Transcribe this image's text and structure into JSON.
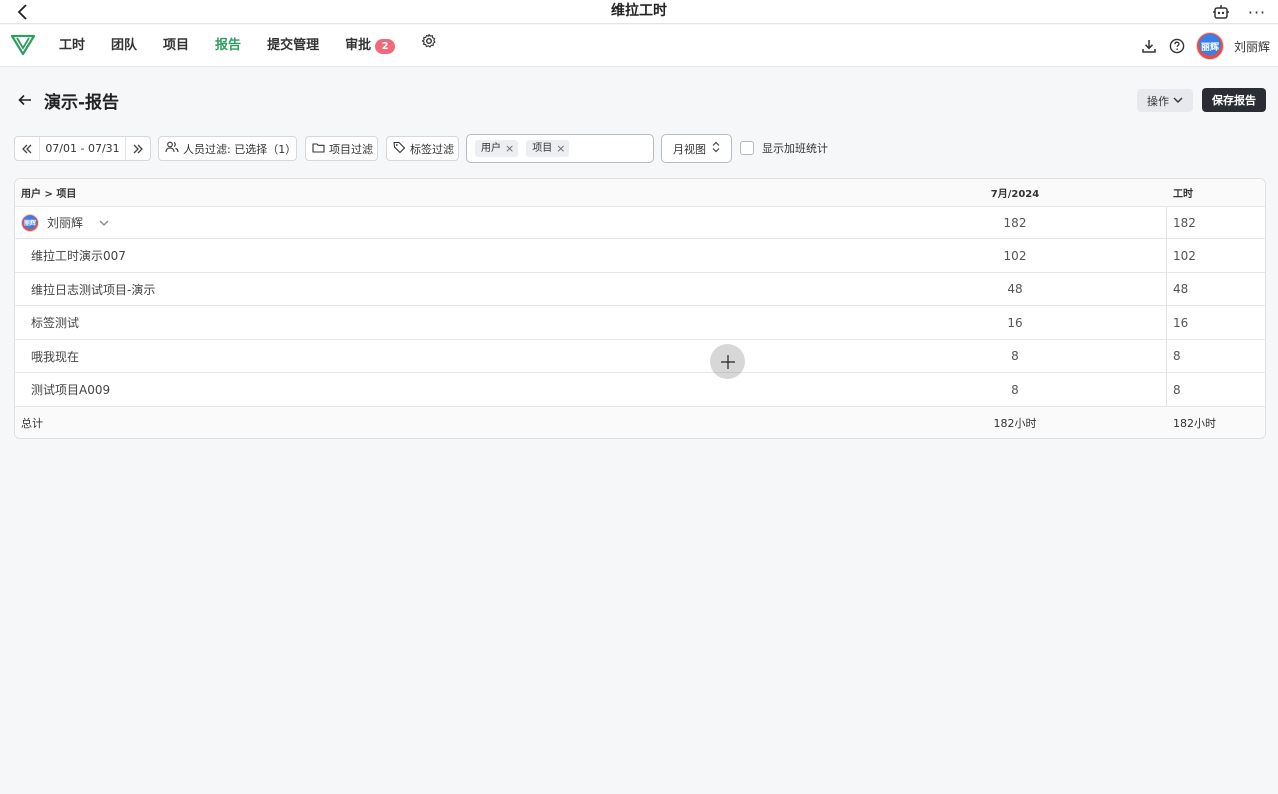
{
  "window": {
    "title": "维拉工时",
    "more_label": "···"
  },
  "nav": {
    "items": [
      {
        "label": "工时"
      },
      {
        "label": "团队"
      },
      {
        "label": "项目"
      },
      {
        "label": "报告"
      },
      {
        "label": "提交管理"
      },
      {
        "label": "审批"
      }
    ],
    "active": "报告",
    "approval_badge": "2",
    "username": "刘丽辉",
    "avatar_text": "丽辉",
    "accent_color": "#2f9e5f",
    "badge_color": "#f26a7a"
  },
  "page": {
    "title": "演示-报告",
    "ops_label": "操作",
    "save_label": "保存报告"
  },
  "filters": {
    "date_range": "07/01 - 07/31",
    "member_filter": "人员过滤: 已选择（1）",
    "project_filter": "项目过滤",
    "tag_filter": "标签过滤",
    "group_tags": [
      {
        "label": "用户"
      },
      {
        "label": "项目"
      }
    ],
    "view_mode": "月视图",
    "overtime_label": "显示加班统计",
    "overtime_checked": false
  },
  "table": {
    "headers": {
      "col1": "用户 > 项目",
      "col2": "7月/2024",
      "col3": "工时"
    },
    "user_row": {
      "name": "刘丽辉",
      "month": "182",
      "hours": "182"
    },
    "project_rows": [
      {
        "name": "维拉工时演示007",
        "month": "102",
        "hours": "102"
      },
      {
        "name": "维拉日志测试项目-演示",
        "month": "48",
        "hours": "48"
      },
      {
        "name": "标签测试",
        "month": "16",
        "hours": "16"
      },
      {
        "name": "哦我现在",
        "month": "8",
        "hours": "8"
      },
      {
        "name": "测试项目A009",
        "month": "8",
        "hours": "8"
      }
    ],
    "total": {
      "label": "总计",
      "month": "182小时",
      "hours": "182小时"
    }
  }
}
